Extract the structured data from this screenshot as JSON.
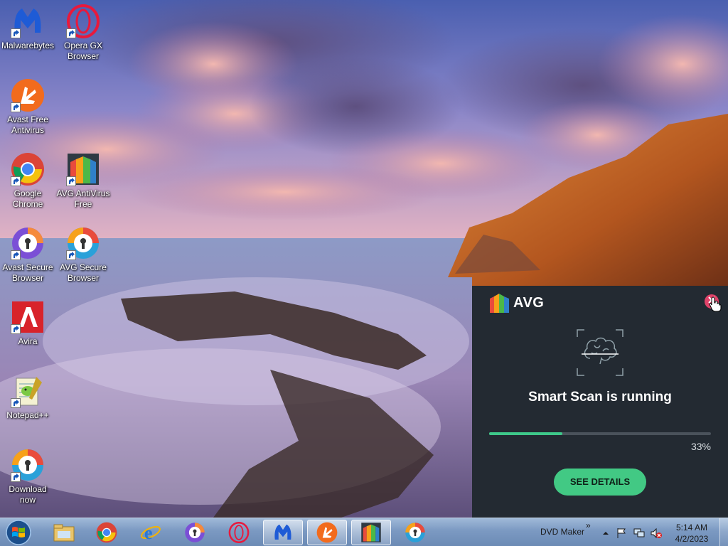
{
  "desktop": {
    "icons": [
      {
        "label": "Malwarebytes",
        "icon": "malwarebytes-icon"
      },
      {
        "label": "Opera GX\nBrowser",
        "icon": "opera-gx-icon"
      },
      {
        "label": "Avast Free\nAntivirus",
        "icon": "avast-icon"
      },
      {
        "label": "Google\nChrome",
        "icon": "chrome-icon"
      },
      {
        "label": "AVG AntiVirus\nFree",
        "icon": "avg-antivirus-icon"
      },
      {
        "label": "Avast Secure\nBrowser",
        "icon": "avast-secure-browser-icon"
      },
      {
        "label": "AVG Secure\nBrowser",
        "icon": "avg-secure-browser-icon"
      },
      {
        "label": "Avira",
        "icon": "avira-icon"
      },
      {
        "label": "Notepad++",
        "icon": "notepadpp-icon"
      },
      {
        "label": "Download\nnow",
        "icon": "download-now-icon"
      }
    ]
  },
  "avg_popup": {
    "logo_text": "AVG",
    "title": "Smart Scan is running",
    "progress_percent": 33,
    "progress_label": "33%",
    "button_label": "SEE DETAILS",
    "colors": {
      "background": "#232a32",
      "accent": "#42c984",
      "close": "#e0436a"
    }
  },
  "taskbar": {
    "toolbar_label": "DVD Maker",
    "toolbar_chevron": "»",
    "clock_time": "5:14 AM",
    "clock_date": "4/2/2023",
    "pinned": [
      {
        "icon": "explorer-icon"
      },
      {
        "icon": "chrome-icon"
      },
      {
        "icon": "internet-explorer-icon"
      },
      {
        "icon": "avast-secure-browser-icon"
      },
      {
        "icon": "opera-icon"
      },
      {
        "icon": "malwarebytes-icon"
      },
      {
        "icon": "avast-icon"
      },
      {
        "icon": "avg-icon"
      },
      {
        "icon": "avg-secure-browser-icon"
      }
    ]
  }
}
